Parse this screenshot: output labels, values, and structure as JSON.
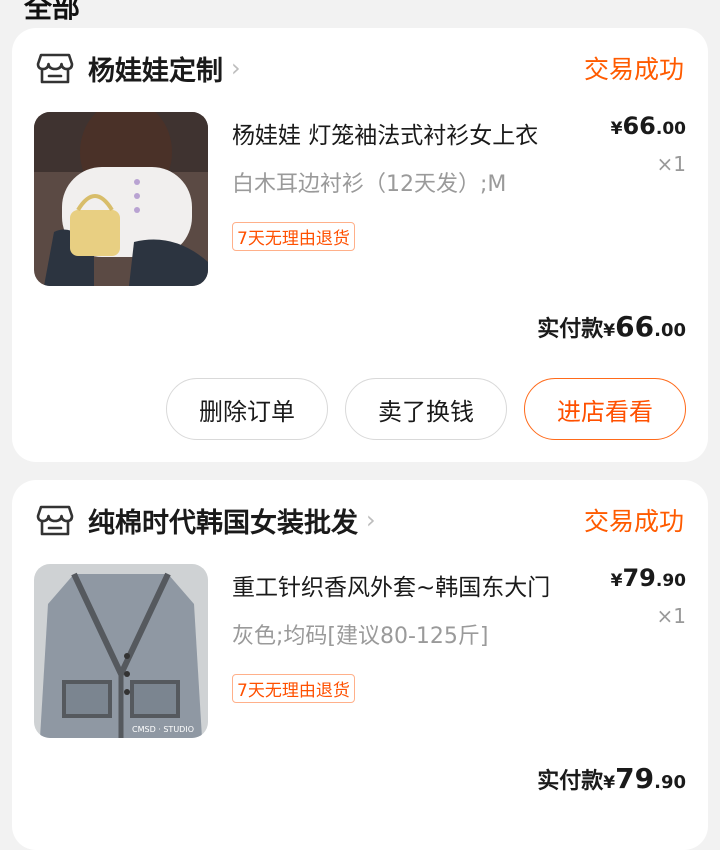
{
  "header": {
    "title_partial": "全部"
  },
  "orders": [
    {
      "shop": {
        "name": "杨娃娃定制",
        "chevron": "›"
      },
      "status": "交易成功",
      "item": {
        "title": "杨娃娃 灯笼袖法式衬衫女上衣",
        "sku": "白木耳边衬衫（12天发）;M",
        "tag": "7天无理由退货",
        "price_symbol": "¥",
        "price_int": "66",
        "price_dec": ".00",
        "qty": "×1"
      },
      "paid": {
        "label": "实付款",
        "symbol": "¥",
        "int": "66",
        "dec": ".00"
      },
      "buttons": {
        "delete": "删除订单",
        "sell": "卖了换钱",
        "shop": "进店看看"
      }
    },
    {
      "shop": {
        "name": "纯棉时代韩国女装批发",
        "chevron": "›"
      },
      "status": "交易成功",
      "item": {
        "title": "重工针织香风外套~韩国东大门",
        "sku": "灰色;均码[建议80-125斤]",
        "tag": "7天无理由退货",
        "price_symbol": "¥",
        "price_int": "79",
        "price_dec": ".90",
        "qty": "×1",
        "image_watermark": "CMSD · STUDIO"
      },
      "paid": {
        "label": "实付款",
        "symbol": "¥",
        "int": "79",
        "dec": ".90"
      }
    }
  ],
  "colors": {
    "accent": "#ff5000",
    "background": "#f2f2f2",
    "card": "#ffffff"
  },
  "icons": {
    "shop": "store-icon",
    "chevron": "chevron-right-icon"
  }
}
